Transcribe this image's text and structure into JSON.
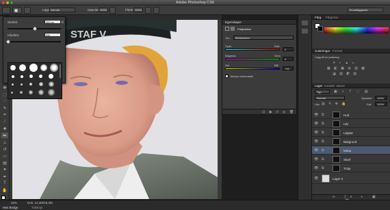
{
  "window": {
    "title": "Adobe Photoshop CS6",
    "workspace": "Grundläggande"
  },
  "options_bar": {
    "mode_label": "Läge:",
    "mode_value": "Normal",
    "opacity_label": "Opacitet:",
    "opacity_value": "100%",
    "flow_label": "Flöde:",
    "flow_value": "100%"
  },
  "brush_popup": {
    "size_label": "Storlek:",
    "size_value": "300 px",
    "hardness_label": "Hårdhet:",
    "hardness_value": "0%"
  },
  "properties": {
    "tab": "Egenskaper",
    "title": "Färgbalans",
    "tone_label": "Ton:",
    "tone_value": "Mellantoner",
    "sliders": [
      {
        "left": "Cyan",
        "right": "Röd",
        "value": "0"
      },
      {
        "left": "Magenta",
        "right": "Grön",
        "value": "0"
      },
      {
        "left": "Gul",
        "right": "Blå",
        "value": "+53"
      }
    ],
    "preserve_label": "Bevara luminositet"
  },
  "right_panel": {
    "color_tabs": [
      "Färg",
      "Färgrutor"
    ],
    "adjust_tabs": [
      "Justeringar",
      "Format"
    ],
    "adjust_hint": "Lägg till en justering",
    "layer_tabs": [
      "Lager",
      "Kanaler",
      "Banor"
    ],
    "kind_value": "Typ",
    "blend_value": "Normal",
    "opacity_label": "Opacitet:",
    "opacity_value": "100%",
    "lock_label": "Lås:",
    "fill_label": "Fyll:",
    "fill_value": "100%",
    "layers": [
      {
        "name": "Hud",
        "selected": false
      },
      {
        "name": "Hår",
        "selected": false
      },
      {
        "name": "Läppar",
        "selected": false
      },
      {
        "name": "Bakgrund",
        "selected": false
      },
      {
        "name": "Mösa",
        "selected": true
      },
      {
        "name": "Skarf",
        "selected": false
      },
      {
        "name": "Tröja",
        "selected": false
      },
      {
        "name": "Lager 0",
        "selected": false
      }
    ]
  },
  "photo": {
    "cap_text": "STAF V"
  },
  "status": {
    "zoom": "33%",
    "doc": "Dok: 12,3M/18,3M",
    "tabs": [
      "Mini Bridge",
      "Tidslinje"
    ]
  }
}
